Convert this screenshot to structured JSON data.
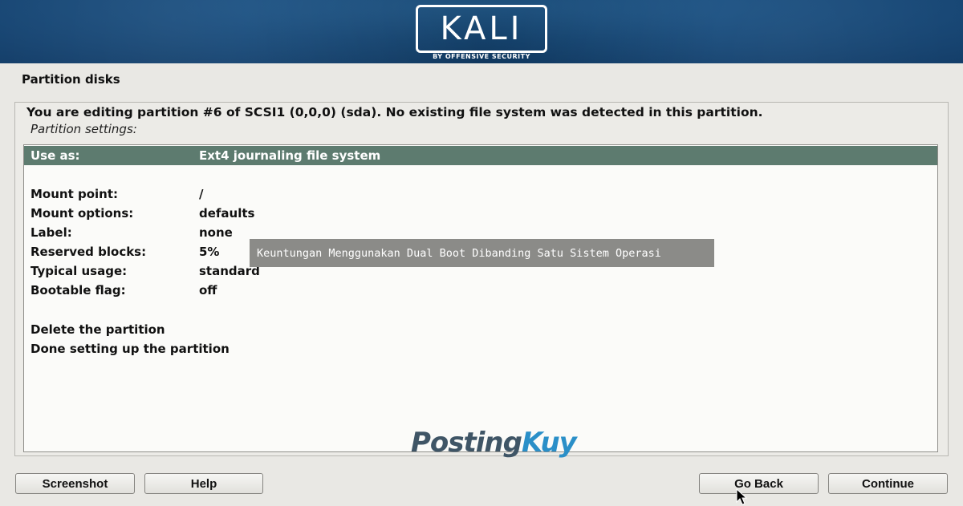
{
  "header": {
    "logo_text": "KALI",
    "logo_subtitle": "BY OFFENSIVE SECURITY"
  },
  "page": {
    "title": "Partition disks",
    "description": "You are editing partition #6 of SCSI1 (0,0,0) (sda). No existing file system was detected in this partition.",
    "settings_label": "Partition settings:"
  },
  "settings": [
    {
      "key": "Use as:",
      "value": "Ext4 journaling file system",
      "selected": true
    },
    {
      "key": "Mount point:",
      "value": "/"
    },
    {
      "key": "Mount options:",
      "value": "defaults"
    },
    {
      "key": "Label:",
      "value": "none"
    },
    {
      "key": "Reserved blocks:",
      "value": "5%"
    },
    {
      "key": "Typical usage:",
      "value": "standard"
    },
    {
      "key": "Bootable flag:",
      "value": "off"
    }
  ],
  "actions": [
    {
      "label": "Delete the partition"
    },
    {
      "label": "Done setting up the partition"
    }
  ],
  "overlay_caption": "Keuntungan Menggunakan Dual Boot Dibanding Satu Sistem Operasi",
  "watermark": {
    "part1": "Posting",
    "part2": "Kuy"
  },
  "buttons": {
    "screenshot": "Screenshot",
    "help": "Help",
    "go_back": "Go Back",
    "continue": "Continue"
  },
  "colors": {
    "banner": "#184c7d",
    "selected_row": "#5d7b6f",
    "background": "#e9e8e4"
  }
}
